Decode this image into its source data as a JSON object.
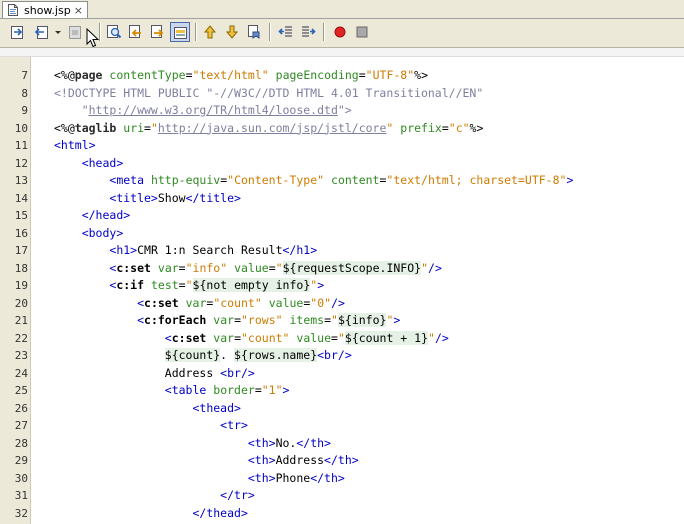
{
  "tab": {
    "filename": "show.jsp",
    "close_glyph": "×"
  },
  "toolbar": {
    "buttons": [
      "last-edit-icon",
      "back-icon",
      "forward-icon",
      "find-selection-icon",
      "find-previous-icon",
      "find-next-icon",
      "toggle-highlight-icon",
      "previous-bookmark-icon",
      "next-bookmark-icon",
      "toggle-bookmark-icon",
      "shift-left-icon",
      "shift-right-icon",
      "record-macro-icon",
      "stop-macro-icon"
    ]
  },
  "editor": {
    "lines": [
      {
        "n": "7",
        "segs": [
          [
            "t-dir",
            "<%@"
          ],
          [
            "t-kw",
            "page"
          ],
          [
            "t-txt",
            " "
          ],
          [
            "t-attr",
            "contentType"
          ],
          [
            "t-txt",
            "="
          ],
          [
            "t-str",
            "\"text/html\""
          ],
          [
            "t-txt",
            " "
          ],
          [
            "t-attr",
            "pageEncoding"
          ],
          [
            "t-txt",
            "="
          ],
          [
            "t-str",
            "\"UTF-8\""
          ],
          [
            "t-dir",
            "%>"
          ]
        ]
      },
      {
        "n": "8",
        "segs": [
          [
            "t-doc",
            "<!DOCTYPE HTML PUBLIC \"-//W3C//DTD HTML 4.01 Transitional//EN\""
          ]
        ]
      },
      {
        "n": "9",
        "segs": [
          [
            "t-doc",
            "    \""
          ],
          [
            "t-url",
            "http://www.w3.org/TR/html4/loose.dtd"
          ],
          [
            "t-doc",
            "\">"
          ]
        ]
      },
      {
        "n": "10",
        "segs": [
          [
            "t-dir",
            "<%@"
          ],
          [
            "t-kw",
            "taglib"
          ],
          [
            "t-txt",
            " "
          ],
          [
            "t-attr",
            "uri"
          ],
          [
            "t-txt",
            "="
          ],
          [
            "t-str",
            "\""
          ],
          [
            "t-url",
            "http://java.sun.com/jsp/jstl/core"
          ],
          [
            "t-str",
            "\""
          ],
          [
            "t-txt",
            " "
          ],
          [
            "t-attr",
            "prefix"
          ],
          [
            "t-txt",
            "="
          ],
          [
            "t-str",
            "\"c\""
          ],
          [
            "t-dir",
            "%>"
          ]
        ]
      },
      {
        "n": "11",
        "segs": [
          [
            "t-tag",
            "<html>"
          ]
        ]
      },
      {
        "n": "12",
        "segs": [
          [
            "t-txt",
            "    "
          ],
          [
            "t-tag",
            "<head>"
          ]
        ]
      },
      {
        "n": "13",
        "segs": [
          [
            "t-txt",
            "        "
          ],
          [
            "t-tag",
            "<meta"
          ],
          [
            "t-txt",
            " "
          ],
          [
            "t-attr",
            "http-equiv"
          ],
          [
            "t-txt",
            "="
          ],
          [
            "t-str",
            "\"Content-Type\""
          ],
          [
            "t-txt",
            " "
          ],
          [
            "t-attr",
            "content"
          ],
          [
            "t-txt",
            "="
          ],
          [
            "t-str",
            "\"text/html; charset=UTF-8\""
          ],
          [
            "t-tag",
            ">"
          ]
        ]
      },
      {
        "n": "14",
        "segs": [
          [
            "t-txt",
            "        "
          ],
          [
            "t-tag",
            "<title>"
          ],
          [
            "t-txt",
            "Show"
          ],
          [
            "t-tag",
            "</title>"
          ]
        ]
      },
      {
        "n": "15",
        "segs": [
          [
            "t-txt",
            "    "
          ],
          [
            "t-tag",
            "</head>"
          ]
        ]
      },
      {
        "n": "16",
        "segs": [
          [
            "t-txt",
            "    "
          ],
          [
            "t-tag",
            "<body>"
          ]
        ]
      },
      {
        "n": "17",
        "segs": [
          [
            "t-txt",
            "        "
          ],
          [
            "t-tag",
            "<h1>"
          ],
          [
            "t-txt",
            "CMR 1:n Search Result"
          ],
          [
            "t-tag",
            "</h1>"
          ]
        ]
      },
      {
        "n": "18",
        "segs": [
          [
            "t-txt",
            "        "
          ],
          [
            "t-cpre",
            "<"
          ],
          [
            "t-clocal",
            "c:set"
          ],
          [
            "t-txt",
            " "
          ],
          [
            "t-attr",
            "var"
          ],
          [
            "t-txt",
            "="
          ],
          [
            "t-str",
            "\"info\""
          ],
          [
            "t-txt",
            " "
          ],
          [
            "t-attr",
            "value"
          ],
          [
            "t-txt",
            "="
          ],
          [
            "t-str",
            "\""
          ],
          [
            "t-el",
            "${requestScope.INFO}"
          ],
          [
            "t-str",
            "\""
          ],
          [
            "t-cpre",
            "/>"
          ]
        ]
      },
      {
        "n": "19",
        "segs": [
          [
            "t-txt",
            "        "
          ],
          [
            "t-cpre",
            "<"
          ],
          [
            "t-clocal",
            "c:if"
          ],
          [
            "t-txt",
            " "
          ],
          [
            "t-attr",
            "test"
          ],
          [
            "t-txt",
            "="
          ],
          [
            "t-str",
            "\""
          ],
          [
            "t-el",
            "${not empty info}"
          ],
          [
            "t-str",
            "\""
          ],
          [
            "t-cpre",
            ">"
          ]
        ]
      },
      {
        "n": "20",
        "segs": [
          [
            "t-txt",
            "            "
          ],
          [
            "t-cpre",
            "<"
          ],
          [
            "t-clocal",
            "c:set"
          ],
          [
            "t-txt",
            " "
          ],
          [
            "t-attr",
            "var"
          ],
          [
            "t-txt",
            "="
          ],
          [
            "t-str",
            "\"count\""
          ],
          [
            "t-txt",
            " "
          ],
          [
            "t-attr",
            "value"
          ],
          [
            "t-txt",
            "="
          ],
          [
            "t-str",
            "\"0\""
          ],
          [
            "t-cpre",
            "/>"
          ]
        ]
      },
      {
        "n": "21",
        "segs": [
          [
            "t-txt",
            "            "
          ],
          [
            "t-cpre",
            "<"
          ],
          [
            "t-clocal",
            "c:forEach"
          ],
          [
            "t-txt",
            " "
          ],
          [
            "t-attr",
            "var"
          ],
          [
            "t-txt",
            "="
          ],
          [
            "t-str",
            "\"rows\""
          ],
          [
            "t-txt",
            " "
          ],
          [
            "t-attr",
            "items"
          ],
          [
            "t-txt",
            "="
          ],
          [
            "t-str",
            "\""
          ],
          [
            "t-el",
            "${info}"
          ],
          [
            "t-str",
            "\""
          ],
          [
            "t-cpre",
            ">"
          ]
        ]
      },
      {
        "n": "22",
        "segs": [
          [
            "t-txt",
            "                "
          ],
          [
            "t-cpre",
            "<"
          ],
          [
            "t-clocal",
            "c:set"
          ],
          [
            "t-txt",
            " "
          ],
          [
            "t-attr",
            "var"
          ],
          [
            "t-txt",
            "="
          ],
          [
            "t-str",
            "\"count\""
          ],
          [
            "t-txt",
            " "
          ],
          [
            "t-attr",
            "value"
          ],
          [
            "t-txt",
            "="
          ],
          [
            "t-str",
            "\""
          ],
          [
            "t-el",
            "${count + 1}"
          ],
          [
            "t-str",
            "\""
          ],
          [
            "t-cpre",
            "/>"
          ]
        ]
      },
      {
        "n": "23",
        "segs": [
          [
            "t-txt",
            "                "
          ],
          [
            "t-el",
            "${count}"
          ],
          [
            "t-txt",
            ". "
          ],
          [
            "t-el",
            "${rows.name}"
          ],
          [
            "t-tag",
            "<br/>"
          ]
        ]
      },
      {
        "n": "24",
        "segs": [
          [
            "t-txt",
            "                Address "
          ],
          [
            "t-tag",
            "<br/>"
          ]
        ]
      },
      {
        "n": "25",
        "segs": [
          [
            "t-txt",
            "                "
          ],
          [
            "t-tag",
            "<table"
          ],
          [
            "t-txt",
            " "
          ],
          [
            "t-attr",
            "border"
          ],
          [
            "t-txt",
            "="
          ],
          [
            "t-str",
            "\"1\""
          ],
          [
            "t-tag",
            ">"
          ]
        ]
      },
      {
        "n": "26",
        "segs": [
          [
            "t-txt",
            "                    "
          ],
          [
            "t-tag",
            "<thead>"
          ]
        ]
      },
      {
        "n": "27",
        "segs": [
          [
            "t-txt",
            "                        "
          ],
          [
            "t-tag",
            "<tr>"
          ]
        ]
      },
      {
        "n": "28",
        "segs": [
          [
            "t-txt",
            "                            "
          ],
          [
            "t-tag",
            "<th>"
          ],
          [
            "t-txt",
            "No."
          ],
          [
            "t-tag",
            "</th>"
          ]
        ]
      },
      {
        "n": "29",
        "segs": [
          [
            "t-txt",
            "                            "
          ],
          [
            "t-tag",
            "<th>"
          ],
          [
            "t-txt",
            "Address"
          ],
          [
            "t-tag",
            "</th>"
          ]
        ]
      },
      {
        "n": "30",
        "segs": [
          [
            "t-txt",
            "                            "
          ],
          [
            "t-tag",
            "<th>"
          ],
          [
            "t-txt",
            "Phone"
          ],
          [
            "t-tag",
            "</th>"
          ]
        ]
      },
      {
        "n": "31",
        "segs": [
          [
            "t-txt",
            "                        "
          ],
          [
            "t-tag",
            "</tr>"
          ]
        ]
      },
      {
        "n": "32",
        "segs": [
          [
            "t-txt",
            "                    "
          ],
          [
            "t-tag",
            "</thead>"
          ]
        ]
      }
    ]
  }
}
